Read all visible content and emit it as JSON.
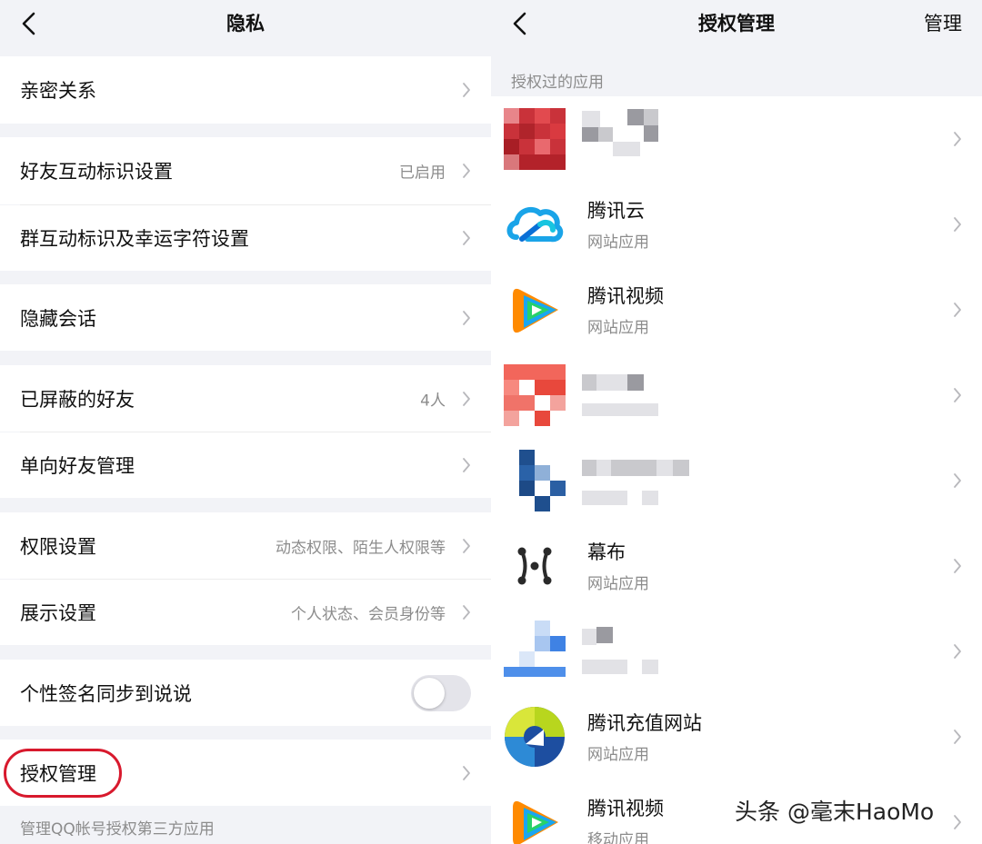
{
  "left": {
    "title": "隐私",
    "items": [
      {
        "label": "亲密关系",
        "value": ""
      },
      {
        "label": "好友互动标识设置",
        "value": "已启用"
      },
      {
        "label": "群互动标识及幸运字符设置",
        "value": ""
      },
      {
        "label": "隐藏会话",
        "value": ""
      },
      {
        "label": "已屏蔽的好友",
        "value": "4人"
      },
      {
        "label": "单向好友管理",
        "value": ""
      },
      {
        "label": "权限设置",
        "value": "动态权限、陌生人权限等"
      },
      {
        "label": "展示设置",
        "value": "个人状态、会员身份等"
      },
      {
        "label": "个性签名同步到说说",
        "toggle": false
      },
      {
        "label": "授权管理",
        "value": ""
      }
    ],
    "footnote": "管理QQ帐号授权第三方应用"
  },
  "right": {
    "title": "授权管理",
    "action": "管理",
    "section_header": "授权过的应用",
    "apps": [
      {
        "name": "",
        "type": "",
        "icon": "blurred-red-icon"
      },
      {
        "name": "腾讯云",
        "type": "网站应用",
        "icon": "tencent-cloud-icon"
      },
      {
        "name": "腾讯视频",
        "type": "网站应用",
        "icon": "tencent-video-icon"
      },
      {
        "name": "",
        "type": "",
        "icon": "blurred-red-icon"
      },
      {
        "name": "",
        "type": "",
        "icon": "blurred-blue-icon"
      },
      {
        "name": "幕布",
        "type": "网站应用",
        "icon": "mubu-icon"
      },
      {
        "name": "",
        "type": "",
        "icon": "blurred-lightblue-icon"
      },
      {
        "name": "腾讯充值网站",
        "type": "网站应用",
        "icon": "tencent-recharge-icon"
      },
      {
        "name": "腾讯视频",
        "type": "移动应用",
        "icon": "tencent-video-icon"
      }
    ]
  },
  "watermark": "头条 @毫末HaoMo",
  "colors": {
    "background": "#f2f3f7",
    "cell": "#ffffff",
    "secondary_text": "#8c8c8c",
    "highlight_circle": "#d8192d"
  }
}
